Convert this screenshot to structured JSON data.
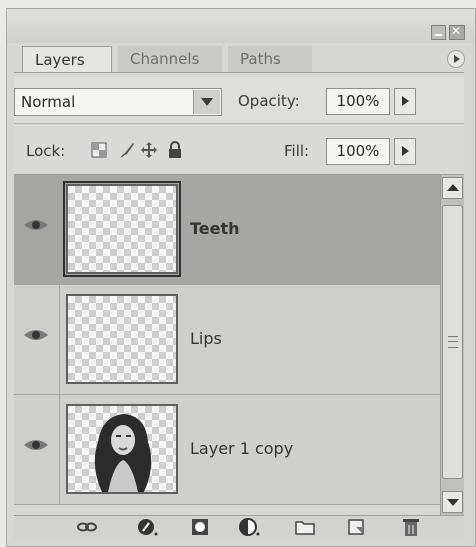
{
  "tabs": {
    "layers": "Layers",
    "channels": "Channels",
    "paths": "Paths"
  },
  "blend_mode": {
    "value": "Normal"
  },
  "opacity": {
    "label": "Opacity:",
    "value": "100%"
  },
  "lock": {
    "label": "Lock:"
  },
  "fill": {
    "label": "Fill:",
    "value": "100%"
  },
  "layers": [
    {
      "name": "Teeth",
      "selected": true,
      "visible": true
    },
    {
      "name": "Lips",
      "selected": false,
      "visible": true
    },
    {
      "name": "Layer 1 copy",
      "selected": false,
      "visible": true
    }
  ],
  "icons": {
    "window": [
      "minimize-icon",
      "close-icon"
    ],
    "lock": [
      "lock-transparent-icon",
      "lock-paint-icon",
      "lock-move-icon",
      "lock-all-icon"
    ],
    "footer": [
      "link-layers-icon",
      "layer-style-icon",
      "layer-mask-icon",
      "adjustment-layer-icon",
      "new-group-icon",
      "new-layer-icon",
      "delete-layer-icon"
    ]
  },
  "colors": {
    "selected_row": "#a6a6a3",
    "panel": "#d6d6d3"
  }
}
